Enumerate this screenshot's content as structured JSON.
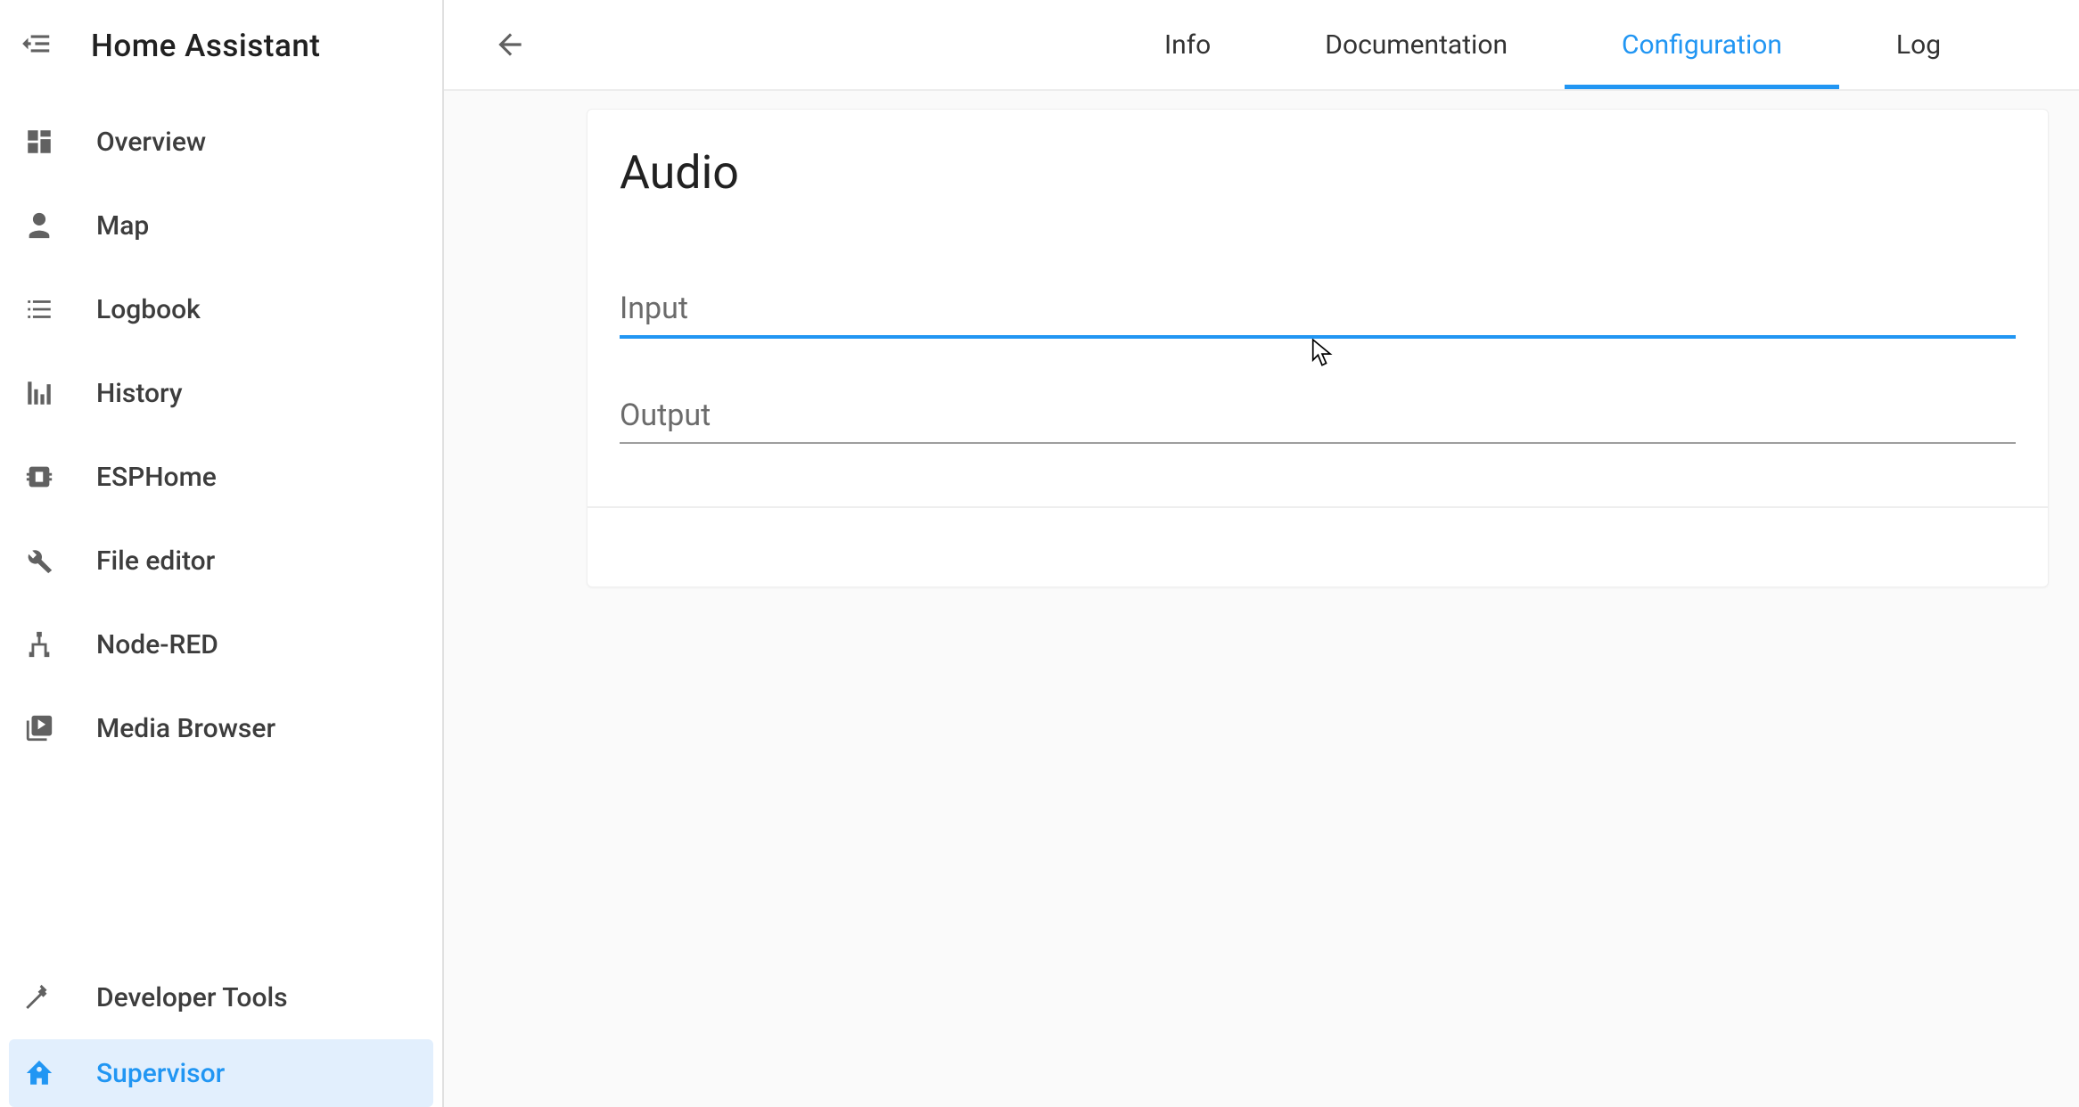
{
  "app": {
    "title": "Home Assistant"
  },
  "sidebar": {
    "items": [
      {
        "key": "overview",
        "label": "Overview"
      },
      {
        "key": "map",
        "label": "Map"
      },
      {
        "key": "logbook",
        "label": "Logbook"
      },
      {
        "key": "history",
        "label": "History"
      },
      {
        "key": "esphome",
        "label": "ESPHome"
      },
      {
        "key": "file-editor",
        "label": "File editor"
      },
      {
        "key": "node-red",
        "label": "Node-RED"
      },
      {
        "key": "media-browser",
        "label": "Media Browser"
      }
    ],
    "bottom": [
      {
        "key": "developer-tools",
        "label": "Developer Tools"
      },
      {
        "key": "supervisor",
        "label": "Supervisor",
        "active": true
      }
    ]
  },
  "tabs": [
    {
      "key": "info",
      "label": "Info"
    },
    {
      "key": "documentation",
      "label": "Documentation"
    },
    {
      "key": "configuration",
      "label": "Configuration",
      "active": true
    },
    {
      "key": "log",
      "label": "Log"
    }
  ],
  "page": {
    "card_title": "Audio",
    "fields": {
      "input": {
        "label": "Input",
        "value": "",
        "focused": true
      },
      "output": {
        "label": "Output",
        "value": "",
        "focused": false
      }
    }
  },
  "colors": {
    "accent": "#2196f3"
  }
}
